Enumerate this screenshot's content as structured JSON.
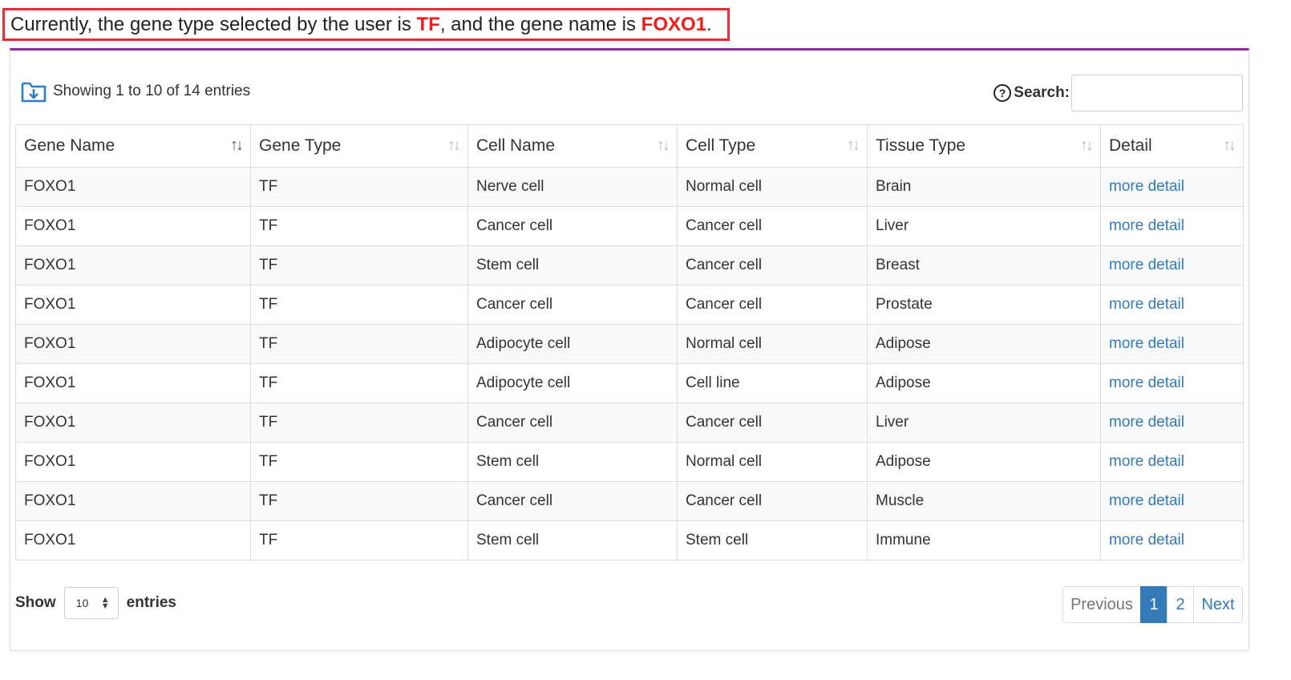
{
  "banner": {
    "prefix": "Currently, the gene type selected by the user is ",
    "gene_type": "TF",
    "middle": ", and the gene name is ",
    "gene_name": "FOXO1",
    "suffix": "."
  },
  "info": {
    "icon": "download-folder-icon",
    "text": "Showing 1 to 10 of 14 entries"
  },
  "search": {
    "icon": "question-circle-icon",
    "label": "Search:",
    "value": "",
    "placeholder": ""
  },
  "table": {
    "columns": [
      {
        "label": "Gene Name",
        "sort_icon": "↑↓"
      },
      {
        "label": "Gene Type",
        "sort_icon": "↑↓"
      },
      {
        "label": "Cell Name",
        "sort_icon": "↑↓"
      },
      {
        "label": "Cell Type",
        "sort_icon": "↑↓"
      },
      {
        "label": "Tissue Type",
        "sort_icon": "↑↓"
      },
      {
        "label": "Detail",
        "sort_icon": "↑↓"
      }
    ],
    "rows": [
      {
        "gene_name": "FOXO1",
        "gene_type": "TF",
        "cell_name": "Nerve cell",
        "cell_type": "Normal cell",
        "tissue_type": "Brain",
        "detail": "more detail"
      },
      {
        "gene_name": "FOXO1",
        "gene_type": "TF",
        "cell_name": "Cancer cell",
        "cell_type": "Cancer cell",
        "tissue_type": "Liver",
        "detail": "more detail"
      },
      {
        "gene_name": "FOXO1",
        "gene_type": "TF",
        "cell_name": "Stem cell",
        "cell_type": "Cancer cell",
        "tissue_type": "Breast",
        "detail": "more detail"
      },
      {
        "gene_name": "FOXO1",
        "gene_type": "TF",
        "cell_name": "Cancer cell",
        "cell_type": "Cancer cell",
        "tissue_type": "Prostate",
        "detail": "more detail"
      },
      {
        "gene_name": "FOXO1",
        "gene_type": "TF",
        "cell_name": "Adipocyte cell",
        "cell_type": "Normal cell",
        "tissue_type": "Adipose",
        "detail": "more detail"
      },
      {
        "gene_name": "FOXO1",
        "gene_type": "TF",
        "cell_name": "Adipocyte cell",
        "cell_type": "Cell line",
        "tissue_type": "Adipose",
        "detail": "more detail"
      },
      {
        "gene_name": "FOXO1",
        "gene_type": "TF",
        "cell_name": "Cancer cell",
        "cell_type": "Cancer cell",
        "tissue_type": "Liver",
        "detail": "more detail"
      },
      {
        "gene_name": "FOXO1",
        "gene_type": "TF",
        "cell_name": "Stem cell",
        "cell_type": "Normal cell",
        "tissue_type": "Adipose",
        "detail": "more detail"
      },
      {
        "gene_name": "FOXO1",
        "gene_type": "TF",
        "cell_name": "Cancer cell",
        "cell_type": "Cancer cell",
        "tissue_type": "Muscle",
        "detail": "more detail"
      },
      {
        "gene_name": "FOXO1",
        "gene_type": "TF",
        "cell_name": "Stem cell",
        "cell_type": "Stem cell",
        "tissue_type": "Immune",
        "detail": "more detail"
      }
    ]
  },
  "length": {
    "label_before": "Show",
    "selected": "10",
    "label_after": "entries"
  },
  "pagination": {
    "previous": "Previous",
    "pages": [
      "1",
      "2"
    ],
    "current": "1",
    "next": "Next"
  },
  "colors": {
    "banner_border": "#ee2a33",
    "highlight": "#ee1c1c",
    "panel_accent": "#9b27a8",
    "link": "#337ab7"
  }
}
